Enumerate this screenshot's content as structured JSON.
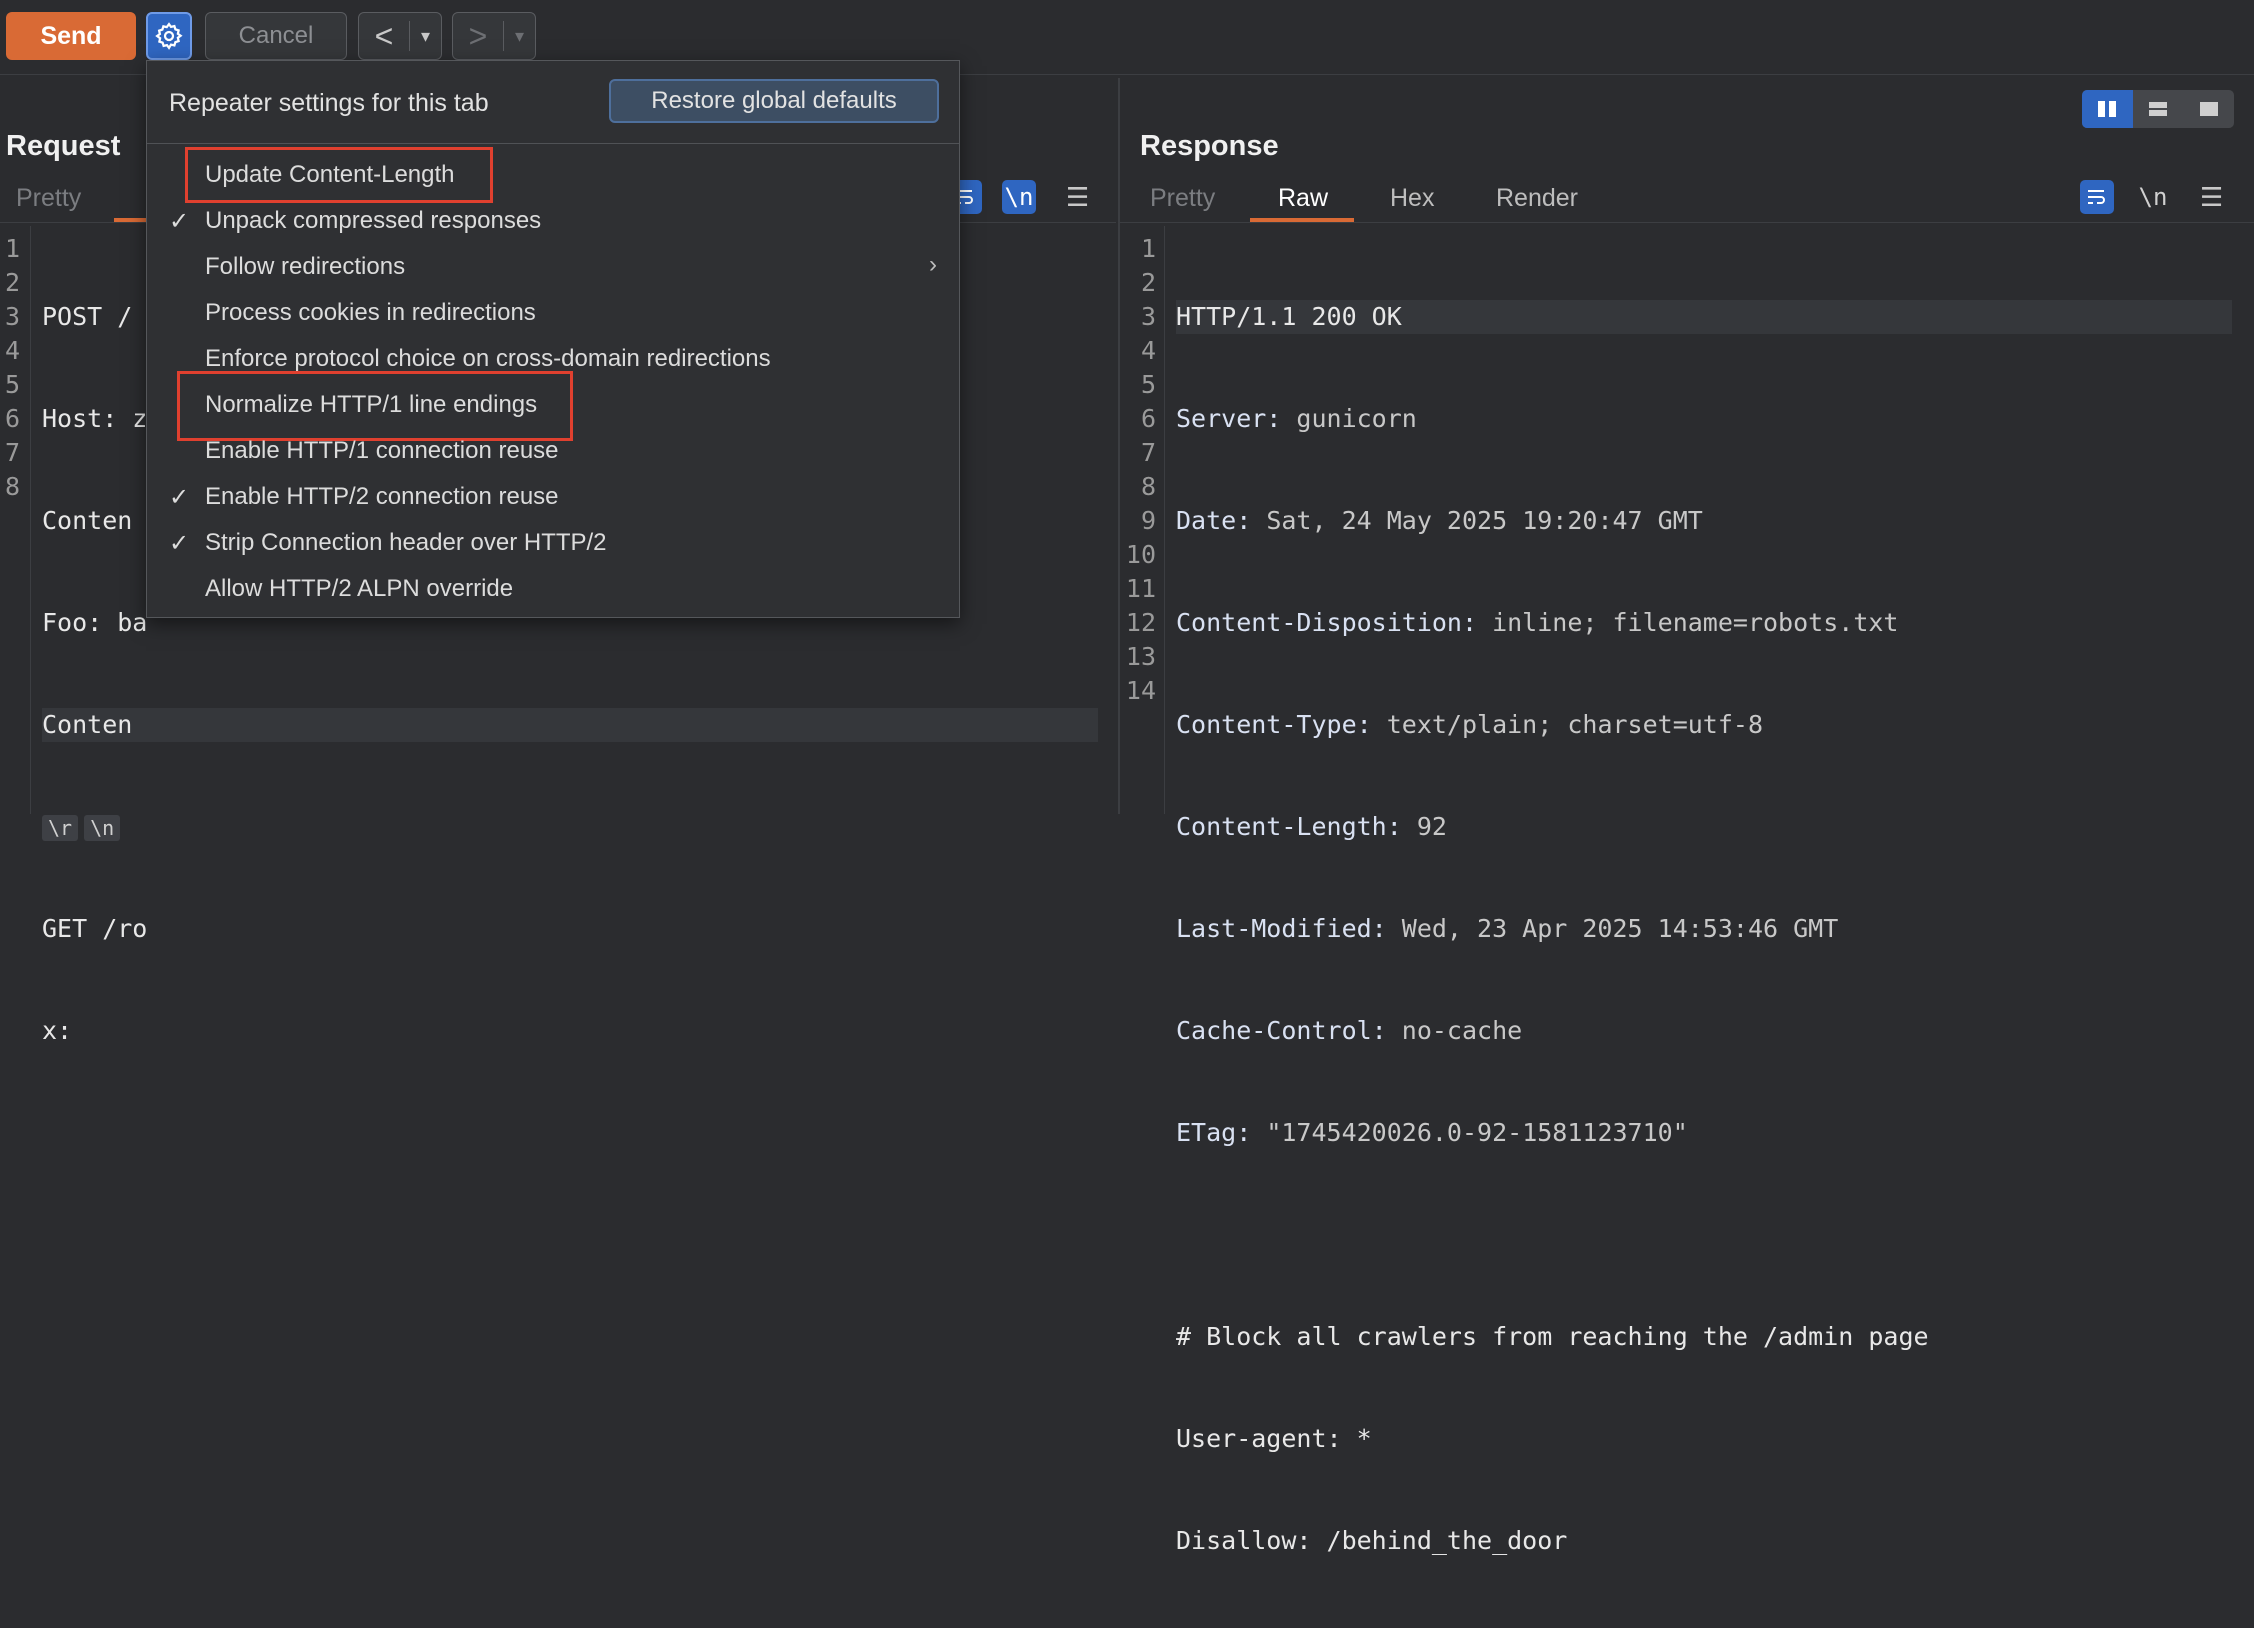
{
  "toolbar": {
    "send_label": "Send",
    "cancel_label": "Cancel",
    "back_arrow": "<",
    "forward_arrow": ">",
    "dropdown_glyph": "▾"
  },
  "request": {
    "title": "Request",
    "tabs": [
      "Pretty"
    ],
    "newline_toggle": "\\n",
    "line_numbers": [
      "1",
      "2",
      "3",
      "4",
      "5",
      "6",
      "7",
      "8"
    ],
    "lines": [
      "POST /",
      "Host: z",
      "Conten",
      "Foo: ba",
      "Conten",
      "",
      "GET /ro",
      "x:"
    ],
    "crlf_tokens": [
      "\\r",
      "\\n"
    ]
  },
  "response": {
    "title": "Response",
    "tabs": [
      "Pretty",
      "Raw",
      "Hex",
      "Render"
    ],
    "newline_toggle": "\\n",
    "line_numbers": [
      "1",
      "2",
      "3",
      "4",
      "5",
      "6",
      "7",
      "8",
      "9",
      "10",
      "11",
      "12",
      "13",
      "14"
    ],
    "status_line": "HTTP/1.1 200 OK",
    "headers": [
      {
        "name": "Server:",
        "value": " gunicorn"
      },
      {
        "name": "Date:",
        "value": " Sat, 24 May 2025 19:20:47 GMT"
      },
      {
        "name": "Content-Disposition:",
        "value": " inline; filename=robots.txt"
      },
      {
        "name": "Content-Type:",
        "value": " text/plain; charset=utf-8"
      },
      {
        "name": "Content-Length:",
        "value": " 92"
      },
      {
        "name": "Last-Modified:",
        "value": " Wed, 23 Apr 2025 14:53:46 GMT"
      },
      {
        "name": "Cache-Control:",
        "value": " no-cache"
      },
      {
        "name": "ETag:",
        "value": " \"1745420026.0-92-1581123710\""
      }
    ],
    "body": [
      "# Block all crawlers from reaching the /admin page",
      "User-agent: *",
      "Disallow: /behind_the_door"
    ]
  },
  "settings_popup": {
    "title": "Repeater settings for this tab",
    "restore_label": "Restore global defaults",
    "options": [
      {
        "label": "Update Content-Length",
        "checked": false,
        "highlighted": true
      },
      {
        "label": "Unpack compressed responses",
        "checked": true
      },
      {
        "label": "Follow redirections",
        "checked": false,
        "submenu": true
      },
      {
        "label": "Process cookies in redirections",
        "checked": false
      },
      {
        "label": "Enforce protocol choice on cross-domain redirections",
        "checked": false
      },
      {
        "label": "Normalize HTTP/1 line endings",
        "checked": false,
        "highlighted": true
      },
      {
        "label": "Enable HTTP/1 connection reuse",
        "checked": false
      },
      {
        "label": "Enable HTTP/2 connection reuse",
        "checked": true
      },
      {
        "label": "Strip Connection header over HTTP/2",
        "checked": true
      },
      {
        "label": "Allow HTTP/2 ALPN override",
        "checked": false
      }
    ],
    "check_glyph": "✓",
    "submenu_glyph": "›"
  },
  "colors": {
    "accent_orange": "#d96a35",
    "accent_blue": "#2f66c1",
    "highlight_red": "#e0402f",
    "background": "#2b2c2f"
  }
}
